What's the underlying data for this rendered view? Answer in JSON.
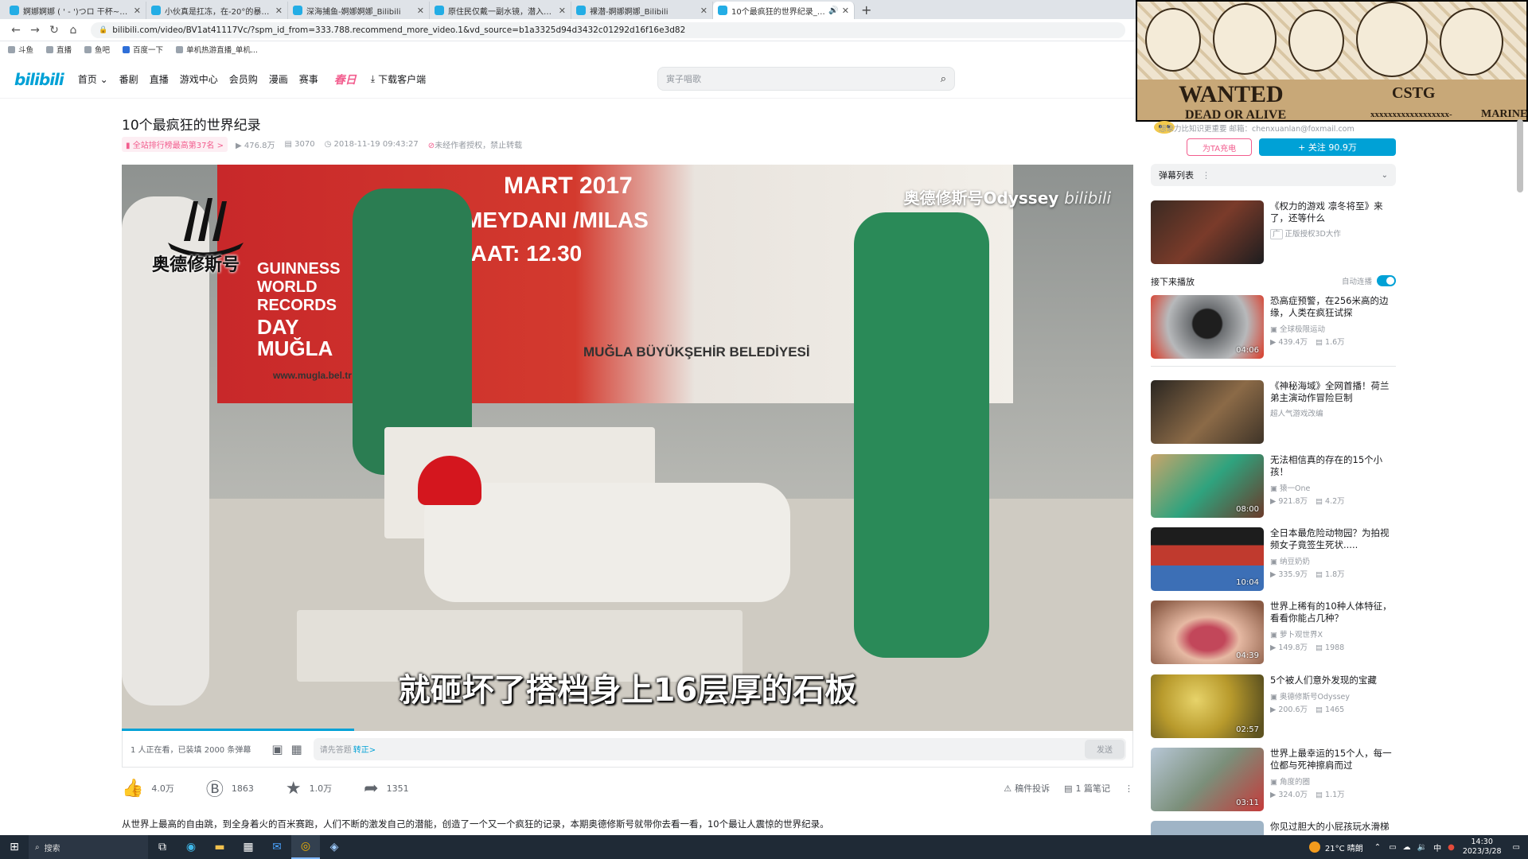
{
  "browser": {
    "tabs": [
      {
        "title": "婀娜婀娜 ( ' - ')つロ 干杯~-bili",
        "active": false
      },
      {
        "title": "小伙真是扛冻，在-20°的暴风雪",
        "active": false
      },
      {
        "title": "深海捕鱼-婀娜婀娜_Bilibili",
        "active": false
      },
      {
        "title": "原住民仅戴一副水镜，潜入15米",
        "active": false
      },
      {
        "title": "裸潜-婀娜婀娜_Bilibili",
        "active": false
      },
      {
        "title": "10个最疯狂的世界纪录_婀娜",
        "active": true
      }
    ],
    "new_tab": "+",
    "url": "bilibili.com/video/BV1at41117Vc/?spm_id_from=333.788.recommend_more_video.1&vd_source=b1a3325d94d3432c01292d16f16e3d82",
    "bookmarks": [
      "斗鱼",
      "直播",
      "鱼吧",
      "百度一下",
      "单机热游直播_单机..."
    ]
  },
  "site": {
    "logo": "bilibili",
    "nav": [
      "首页",
      "番剧",
      "直播",
      "游戏中心",
      "会员购",
      "漫画",
      "赛事"
    ],
    "promo": "春日",
    "download": "下载客户端",
    "search_placeholder": "寅子唱歌"
  },
  "video": {
    "title": "10个最疯狂的世界纪录",
    "rank": "全站排行榜最高第37名",
    "views": "476.8万",
    "danmaku": "3070",
    "date": "2018-11-19 09:43:27",
    "copyright": "未经作者授权，禁止转载",
    "overlay_logo": "奥德修斯号",
    "watermark": "奥德修斯号Odyssey",
    "watermark_brand": "bilibili",
    "subtitle": "就砸坏了搭档身上16层厚的石板",
    "banner_lines": [
      "MART 2017",
      "MEYDANI /MILAS",
      "SAAT: 12.30",
      "GUINNESS",
      "WORLD",
      "RECORDS",
      "DAY",
      "MUĞLA",
      "MUĞLA BÜYÜKŞEHİR BELEDİYESİ",
      "www.mugla.bel.tr"
    ],
    "progress": 0.23
  },
  "danmaku_bar": {
    "status": "1 人正在看，已装填 2000 条弹幕",
    "input_placeholder": "请先答题",
    "input_link": "转正>",
    "send": "发送"
  },
  "actions": {
    "like": "4.0万",
    "coin": "1863",
    "fav": "1.0万",
    "share": "1351",
    "report": "稿件投诉",
    "notes": "1 篇笔记"
  },
  "description": "从世界上最高的自由跳，到全身着火的百米赛跑，人们不断的激发自己的潜能，创造了一个又一个疯狂的记录，本期奥德修斯号就带你去看一看，10个最让人震惊的世界纪录。",
  "manga": {
    "wanted": "WANTED",
    "dead_or_alive": "DEAD OR ALIVE",
    "name": "CSTG",
    "bounty": "xxxxxxxxxxxxxxxxxx-",
    "marine": "MARINE"
  },
  "uploader": {
    "info": "想象力比知识更重要 邮箱：chenxuanlan@foxmail.com",
    "charge": "为TA充电",
    "follow": "+ 关注 90.9万"
  },
  "danmaku_list": {
    "label": "弹幕列表",
    "more": "⋮",
    "chevron": "⌄"
  },
  "up_next": {
    "label": "接下来播放",
    "autoplay": "自动连播"
  },
  "recommendations": [
    {
      "title": "《权力的游戏 凛冬将至》来了，还等什么",
      "author": "正版授权3D大作",
      "views": "",
      "danmaku": "",
      "duration": "",
      "ad": true
    },
    {
      "title": "恐高症预警，在256米高的边缘，人类在疯狂试探",
      "author": "全球极限运动",
      "views": "439.4万",
      "danmaku": "1.6万",
      "duration": "04:06"
    },
    {
      "title": "《神秘海域》全网首播！荷兰弟主演动作冒险巨制",
      "author": "超人气游戏改编",
      "views": "",
      "danmaku": "",
      "duration": "",
      "ad": true
    },
    {
      "title": "无法相信真的存在的15个小孩！",
      "author": "猿一One",
      "views": "921.8万",
      "danmaku": "4.2万",
      "duration": "08:00"
    },
    {
      "title": "全日本最危险动物园？为拍视频女子竟签生死状.....",
      "author": "纳豆奶奶",
      "views": "335.9万",
      "danmaku": "1.8万",
      "duration": "10:04"
    },
    {
      "title": "世界上稀有的10种人体特征，看看你能占几种？",
      "author": "萝卜观世界X",
      "views": "149.8万",
      "danmaku": "1988",
      "duration": "04:39"
    },
    {
      "title": "5个被人们意外发现的宝藏",
      "author": "奥德修斯号Odyssey",
      "views": "200.6万",
      "danmaku": "1465",
      "duration": "02:57"
    },
    {
      "title": "世界上最幸运的15个人，每一位都与死神擦肩而过",
      "author": "角度的圈",
      "views": "324.0万",
      "danmaku": "1.1万",
      "duration": "03:11"
    },
    {
      "title": "你见过胆大的小屁孩玩水滑梯",
      "author": "",
      "views": "",
      "danmaku": "",
      "duration": ""
    }
  ],
  "taskbar": {
    "search": "搜索",
    "weather": "21°C 晴朗",
    "ime": "中",
    "time": "14:30",
    "date": "2023/3/28"
  },
  "colors": {
    "accent": "#00a1d6",
    "pink": "#f25d8e"
  }
}
